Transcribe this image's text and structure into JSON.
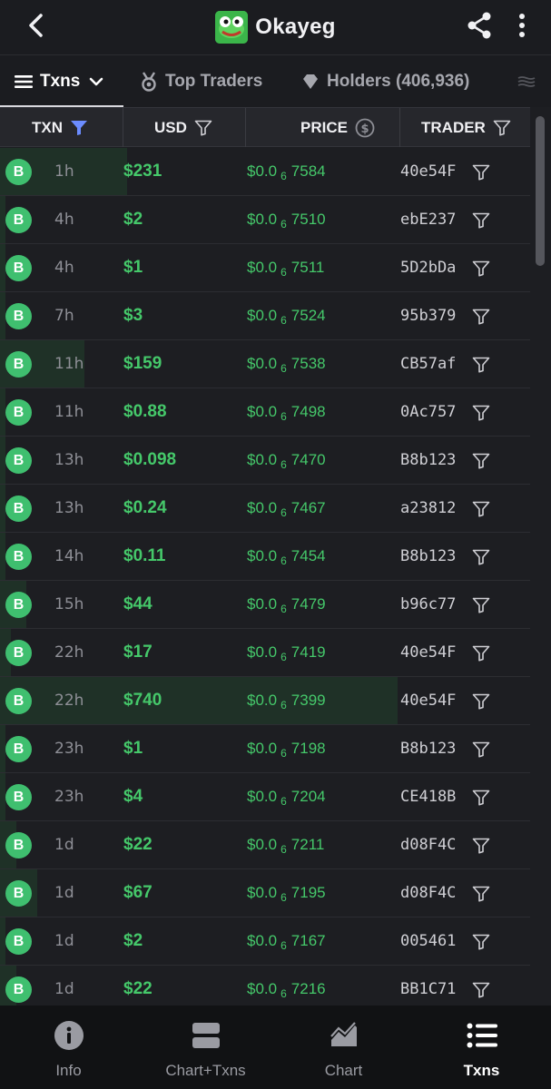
{
  "header": {
    "title": "Okayeg"
  },
  "tabs": [
    {
      "label": "Txns",
      "active": true
    },
    {
      "label": "Top Traders",
      "active": false
    },
    {
      "label": "Holders (406,936)",
      "active": false
    }
  ],
  "columns": {
    "txn": "TXN",
    "usd": "USD",
    "price": "PRICE",
    "trader": "TRADER"
  },
  "price_prefix": "$0.0",
  "price_zero_count": "6",
  "rows": [
    {
      "type": "B",
      "age": "1h",
      "usd": "$231",
      "price": "7584",
      "trader": "40e54F",
      "volume_fraction": 0.24
    },
    {
      "type": "B",
      "age": "4h",
      "usd": "$2",
      "price": "7510",
      "trader": "ebE237",
      "volume_fraction": 0.01
    },
    {
      "type": "B",
      "age": "4h",
      "usd": "$1",
      "price": "7511",
      "trader": "5D2bDa",
      "volume_fraction": 0.01
    },
    {
      "type": "B",
      "age": "7h",
      "usd": "$3",
      "price": "7524",
      "trader": "95b379",
      "volume_fraction": 0.01
    },
    {
      "type": "B",
      "age": "11h",
      "usd": "$159",
      "price": "7538",
      "trader": "CB57af",
      "volume_fraction": 0.16
    },
    {
      "type": "B",
      "age": "11h",
      "usd": "$0.88",
      "price": "7498",
      "trader": "0Ac757",
      "volume_fraction": 0.01
    },
    {
      "type": "B",
      "age": "13h",
      "usd": "$0.098",
      "price": "7470",
      "trader": "B8b123",
      "volume_fraction": 0.01
    },
    {
      "type": "B",
      "age": "13h",
      "usd": "$0.24",
      "price": "7467",
      "trader": "a23812",
      "volume_fraction": 0.01
    },
    {
      "type": "B",
      "age": "14h",
      "usd": "$0.11",
      "price": "7454",
      "trader": "B8b123",
      "volume_fraction": 0.01
    },
    {
      "type": "B",
      "age": "15h",
      "usd": "$44",
      "price": "7479",
      "trader": "b96c77",
      "volume_fraction": 0.05
    },
    {
      "type": "B",
      "age": "22h",
      "usd": "$17",
      "price": "7419",
      "trader": "40e54F",
      "volume_fraction": 0.02
    },
    {
      "type": "B",
      "age": "22h",
      "usd": "$740",
      "price": "7399",
      "trader": "40e54F",
      "volume_fraction": 0.75
    },
    {
      "type": "B",
      "age": "23h",
      "usd": "$1",
      "price": "7198",
      "trader": "B8b123",
      "volume_fraction": 0.01
    },
    {
      "type": "B",
      "age": "23h",
      "usd": "$4",
      "price": "7204",
      "trader": "CE418B",
      "volume_fraction": 0.01
    },
    {
      "type": "B",
      "age": "1d",
      "usd": "$22",
      "price": "7211",
      "trader": "d08F4C",
      "volume_fraction": 0.03
    },
    {
      "type": "B",
      "age": "1d",
      "usd": "$67",
      "price": "7195",
      "trader": "d08F4C",
      "volume_fraction": 0.07
    },
    {
      "type": "B",
      "age": "1d",
      "usd": "$2",
      "price": "7167",
      "trader": "005461",
      "volume_fraction": 0.01
    },
    {
      "type": "B",
      "age": "1d",
      "usd": "$22",
      "price": "7216",
      "trader": "BB1C71",
      "volume_fraction": 0.03
    }
  ],
  "bottom_nav": [
    {
      "label": "Info",
      "icon": "info-icon",
      "active": false
    },
    {
      "label": "Chart+Txns",
      "icon": "chart-txns-icon",
      "active": false
    },
    {
      "label": "Chart",
      "icon": "chart-icon",
      "active": false
    },
    {
      "label": "Txns",
      "icon": "txns-list-icon",
      "active": true
    }
  ],
  "colors": {
    "buy_green": "#45c86a",
    "accent_blue": "#6b8cff",
    "background": "#1d1e22"
  }
}
